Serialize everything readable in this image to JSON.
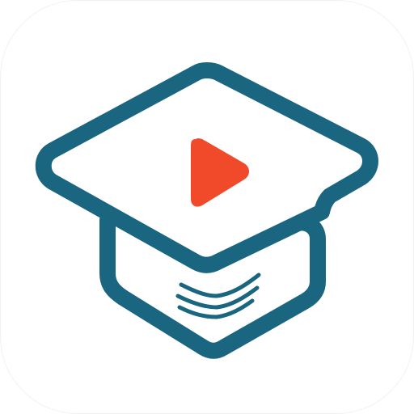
{
  "icon": {
    "name": "graduation-cap-play-icon",
    "colors": {
      "background": "#ffffff",
      "outline": "#1a6680",
      "cap_fill": "#ffffff",
      "play": "#f14a2b"
    }
  }
}
